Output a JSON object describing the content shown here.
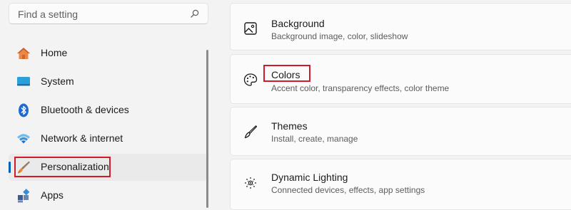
{
  "search": {
    "placeholder": "Find a setting",
    "icon": "search-icon"
  },
  "sidebar": {
    "items": [
      {
        "label": "Home",
        "icon": "home-icon"
      },
      {
        "label": "System",
        "icon": "display-icon"
      },
      {
        "label": "Bluetooth & devices",
        "icon": "bluetooth-icon"
      },
      {
        "label": "Network & internet",
        "icon": "wifi-icon"
      },
      {
        "label": "Personalization",
        "icon": "brush-icon",
        "selected": true
      },
      {
        "label": "Apps",
        "icon": "apps-icon"
      }
    ]
  },
  "main": {
    "cards": [
      {
        "title": "Background",
        "description": "Background image, color, slideshow",
        "icon": "image-icon"
      },
      {
        "title": "Colors",
        "description": "Accent color, transparency effects, color theme",
        "icon": "palette-icon"
      },
      {
        "title": "Themes",
        "description": "Install, create, manage",
        "icon": "brush-outline-icon"
      },
      {
        "title": "Dynamic Lighting",
        "description": "Connected devices, effects, app settings",
        "icon": "lighting-icon"
      }
    ]
  },
  "colors": {
    "accent": "#005fb8",
    "highlight": "#d11a2a"
  }
}
